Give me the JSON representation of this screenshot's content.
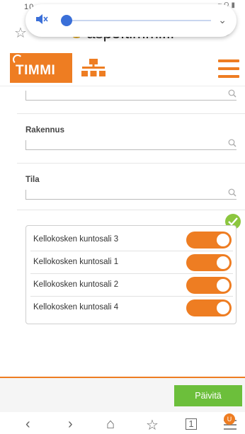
{
  "statusbar": {
    "time": "10",
    "right": "≈ Ω ▮"
  },
  "browser": {
    "url": "asp3.timmi.fi",
    "star_icon": "star-outline-icon",
    "reload_icon": "reload-icon"
  },
  "volume": {
    "level": 0.06,
    "muted": true
  },
  "app": {
    "logo_text": "TIMMI",
    "accent": "#ee7d22",
    "success": "#6cbf3b"
  },
  "fields": [
    {
      "label": "",
      "value": ""
    },
    {
      "label": "Rakennus",
      "value": ""
    },
    {
      "label": "Tila",
      "value": ""
    }
  ],
  "rooms": [
    {
      "label": "Kellokosken kuntosali 3",
      "on": true
    },
    {
      "label": "Kellokosken kuntosali 1",
      "on": true
    },
    {
      "label": "Kellokosken kuntosali 2",
      "on": true
    },
    {
      "label": "Kellokosken kuntosali 4",
      "on": true
    }
  ],
  "update_button": "Päivitä",
  "nav": {
    "back": "‹",
    "forward": "›",
    "home": "⌂",
    "bookmarks": "☆",
    "tabs": "1",
    "menu_badge": "U"
  }
}
